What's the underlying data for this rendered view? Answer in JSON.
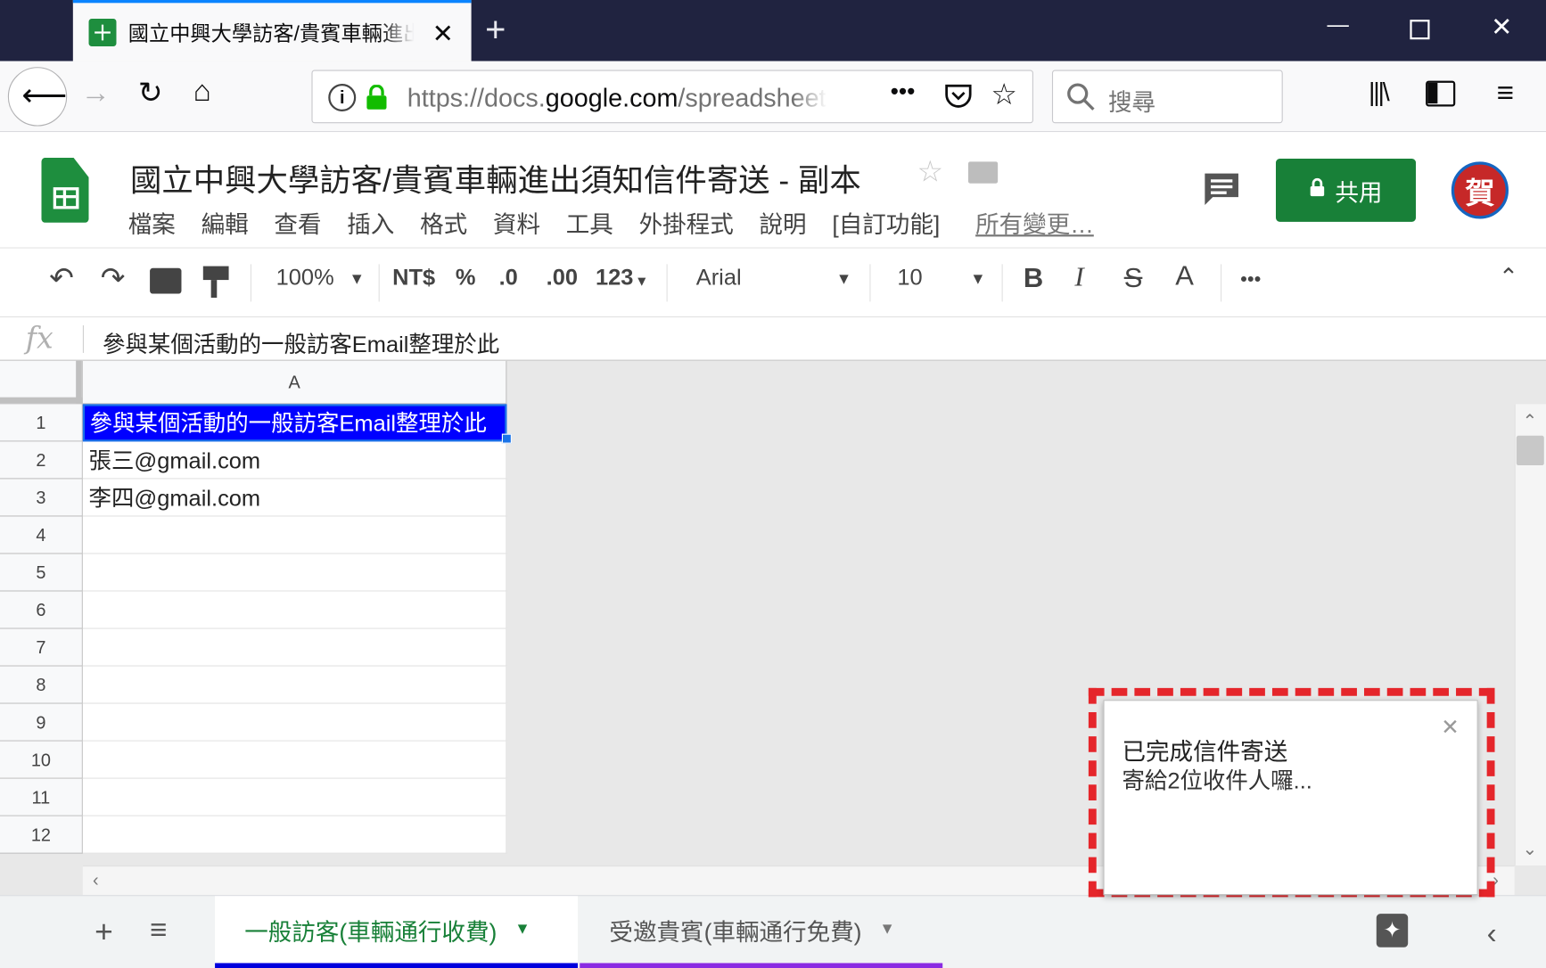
{
  "browser": {
    "tab_title": "國立中興大學訪客/貴賓車輛進出須知信件寄送 - 副本",
    "url_prefix": "https://docs.",
    "url_domain": "google.com",
    "url_path": "/spreadsheets",
    "search_placeholder": "搜尋"
  },
  "doc": {
    "title": "國立中興大學訪客/貴賓車輛進出須知信件寄送 - 副本",
    "menu": [
      "檔案",
      "編輯",
      "查看",
      "插入",
      "格式",
      "資料",
      "工具",
      "外掛程式",
      "說明",
      "[自訂功能]"
    ],
    "last_edit": "所有變更…",
    "share_label": "共用",
    "avatar_text": "賀"
  },
  "toolbar": {
    "zoom": "100%",
    "currency": "NT$",
    "percent": "%",
    "dec_less": ".0",
    "dec_more": ".00",
    "format_123": "123",
    "font": "Arial",
    "font_size": "10",
    "bold": "B",
    "italic": "I",
    "strike": "S",
    "text_color": "A",
    "more": "•••"
  },
  "formula_bar": {
    "fx": "fx",
    "value": "參與某個活動的一般訪客Email整理於此"
  },
  "grid": {
    "column_header": "A",
    "rows": [
      {
        "num": "1",
        "value": "參與某個活動的一般訪客Email整理於此"
      },
      {
        "num": "2",
        "value": "張三@gmail.com"
      },
      {
        "num": "3",
        "value": "李四@gmail.com"
      },
      {
        "num": "4",
        "value": ""
      },
      {
        "num": "5",
        "value": ""
      },
      {
        "num": "6",
        "value": ""
      },
      {
        "num": "7",
        "value": ""
      },
      {
        "num": "8",
        "value": ""
      },
      {
        "num": "9",
        "value": ""
      },
      {
        "num": "10",
        "value": ""
      },
      {
        "num": "11",
        "value": ""
      },
      {
        "num": "12",
        "value": ""
      }
    ]
  },
  "sheets": [
    {
      "label": "一般訪客(車輛通行收費)",
      "active": true
    },
    {
      "label": "受邀貴賓(車輛通行免費)",
      "active": false
    }
  ],
  "toast": {
    "title": "已完成信件寄送",
    "body": "寄給2位收件人囉..."
  },
  "colors": {
    "sheets_green": "#1e8e3e",
    "share_green": "#188038",
    "selection_blue": "#0000ff",
    "highlight_red": "#e5262b",
    "titlebar": "#202340"
  }
}
